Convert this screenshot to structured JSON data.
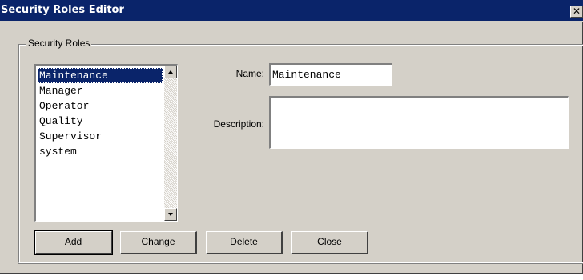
{
  "window": {
    "title": "Security Roles Editor",
    "close_glyph": "✕"
  },
  "group": {
    "legend": "Security Roles"
  },
  "roles_list": {
    "items": [
      "Maintenance",
      "Manager",
      "Operator",
      "Quality",
      "Supervisor",
      "system"
    ],
    "selected": "Maintenance"
  },
  "form": {
    "name_label": "Name:",
    "name_value": "Maintenance",
    "description_label": "Description:",
    "description_value": ""
  },
  "buttons": {
    "add": {
      "accel": "A",
      "rest": "dd"
    },
    "change": {
      "accel": "C",
      "rest": "hange"
    },
    "delete": {
      "accel": "D",
      "rest": "elete"
    },
    "close": {
      "label": "Close"
    }
  },
  "colors": {
    "titlebar": "#0a246a",
    "dialog_face": "#d4d0c8",
    "selection": "#0a246a"
  }
}
